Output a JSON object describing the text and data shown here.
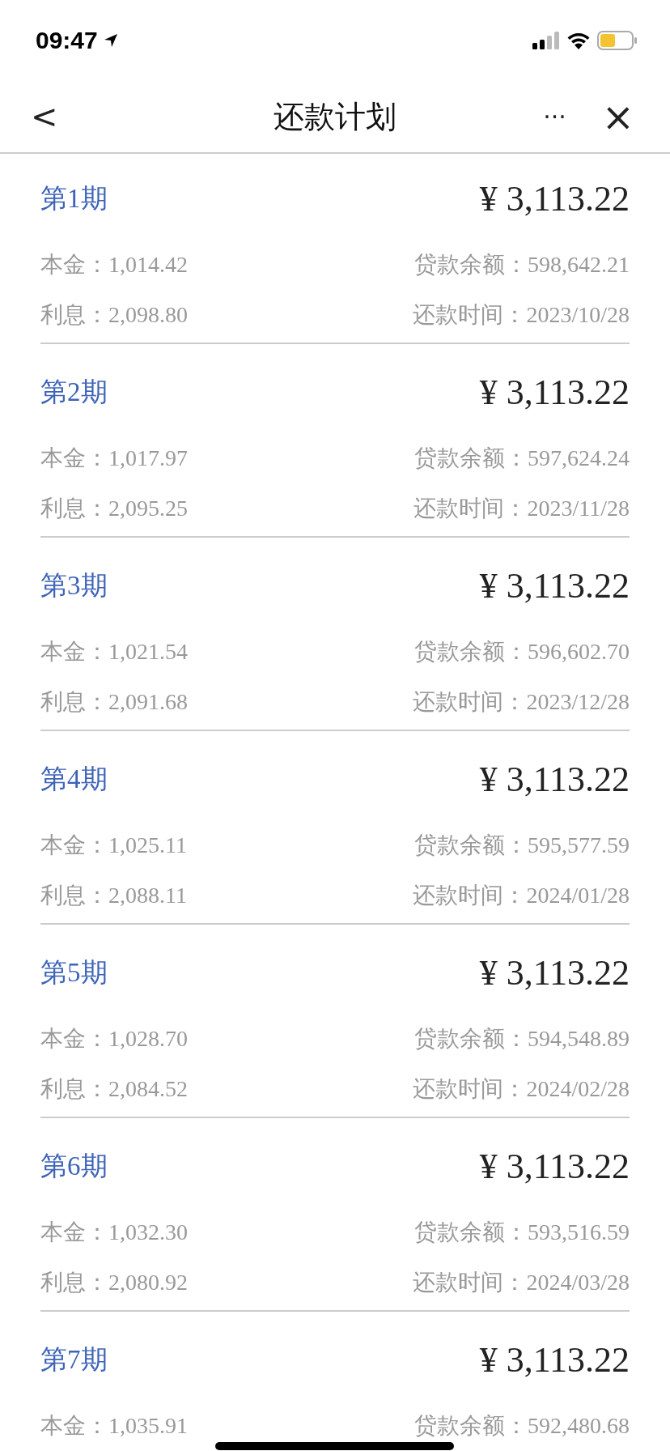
{
  "status_bar": {
    "time": "09:47"
  },
  "nav": {
    "back": "<",
    "title": "还款计划",
    "more": "···",
    "close": "×"
  },
  "periods": [
    {
      "title": "第1期",
      "amount": "¥ 3,113.22",
      "principal_label": "本金：",
      "principal": "1,014.42",
      "balance_label": "贷款余额：",
      "balance": "598,642.21",
      "interest_label": "利息：",
      "interest": "2,098.80",
      "date_label": "还款时间：",
      "date": "2023/10/28"
    },
    {
      "title": "第2期",
      "amount": "¥ 3,113.22",
      "principal_label": "本金：",
      "principal": "1,017.97",
      "balance_label": "贷款余额：",
      "balance": "597,624.24",
      "interest_label": "利息：",
      "interest": "2,095.25",
      "date_label": "还款时间：",
      "date": "2023/11/28"
    },
    {
      "title": "第3期",
      "amount": "¥ 3,113.22",
      "principal_label": "本金：",
      "principal": "1,021.54",
      "balance_label": "贷款余额：",
      "balance": "596,602.70",
      "interest_label": "利息：",
      "interest": "2,091.68",
      "date_label": "还款时间：",
      "date": "2023/12/28"
    },
    {
      "title": "第4期",
      "amount": "¥ 3,113.22",
      "principal_label": "本金：",
      "principal": "1,025.11",
      "balance_label": "贷款余额：",
      "balance": "595,577.59",
      "interest_label": "利息：",
      "interest": "2,088.11",
      "date_label": "还款时间：",
      "date": "2024/01/28"
    },
    {
      "title": "第5期",
      "amount": "¥ 3,113.22",
      "principal_label": "本金：",
      "principal": "1,028.70",
      "balance_label": "贷款余额：",
      "balance": "594,548.89",
      "interest_label": "利息：",
      "interest": "2,084.52",
      "date_label": "还款时间：",
      "date": "2024/02/28"
    },
    {
      "title": "第6期",
      "amount": "¥ 3,113.22",
      "principal_label": "本金：",
      "principal": "1,032.30",
      "balance_label": "贷款余额：",
      "balance": "593,516.59",
      "interest_label": "利息：",
      "interest": "2,080.92",
      "date_label": "还款时间：",
      "date": "2024/03/28"
    },
    {
      "title": "第7期",
      "amount": "¥ 3,113.22",
      "principal_label": "本金：",
      "principal": "1,035.91",
      "balance_label": "贷款余额：",
      "balance": "592,480.68"
    }
  ]
}
